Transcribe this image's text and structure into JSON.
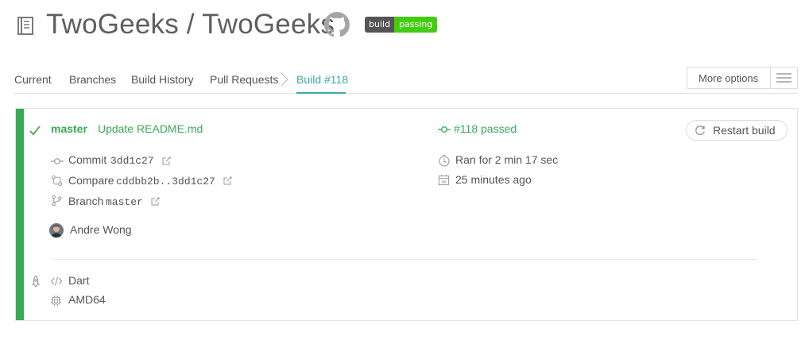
{
  "header": {
    "repo_title": "TwoGeeks / TwoGeeks",
    "badge": {
      "left": "build",
      "right": "passing"
    },
    "icons": {
      "repo": "repo-book-icon",
      "github": "github-icon"
    }
  },
  "tabs": {
    "current": "Current",
    "branches": "Branches",
    "build_history": "Build History",
    "pull_requests": "Pull Requests",
    "active_build": "Build #118"
  },
  "more_options": {
    "label": "More options"
  },
  "build": {
    "branch": "master",
    "commit_message": "Update README.md",
    "status": "#118 passed",
    "restart_label": "Restart build",
    "commit_label": "Commit",
    "commit_sha": "3dd1c27",
    "compare_label": "Compare",
    "compare_range": "cddbb2b..3dd1c27",
    "branch_label": "Branch",
    "branch_value": "master",
    "author": "Andre Wong",
    "duration": "Ran for 2 min 17 sec",
    "finished": "25 minutes ago",
    "language": "Dart",
    "arch": "AMD64"
  },
  "colors": {
    "passed": "#39aa56",
    "accent": "#39aaa4",
    "badge_gray": "#555555",
    "badge_green": "#44cc11"
  }
}
